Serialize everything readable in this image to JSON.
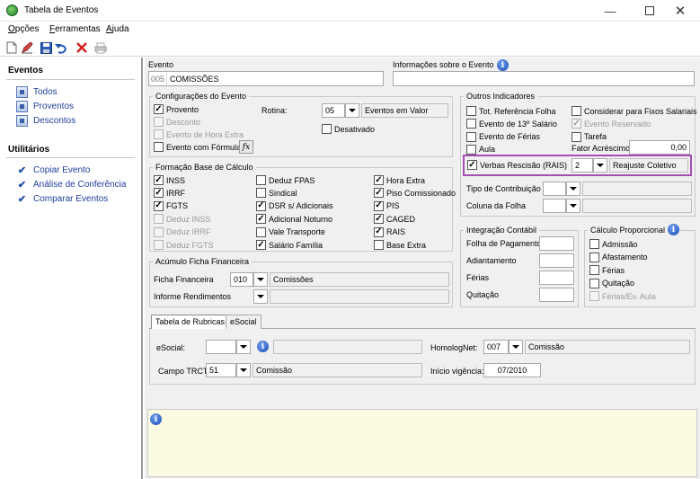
{
  "window": {
    "title": "Tabela de Eventos"
  },
  "menu": [
    {
      "label": "Opções",
      "u": "O",
      "rest": "pções"
    },
    {
      "label": "Ferramentas",
      "u": "F",
      "rest": "erramentas"
    },
    {
      "label": "Ajuda",
      "u": "A",
      "rest": "juda"
    }
  ],
  "toolbar": [
    "new-document",
    "edit",
    "save",
    "undo",
    "delete",
    "print"
  ],
  "sidebar": {
    "eventos_heading": "Eventos",
    "eventos": [
      "Todos",
      "Proventos",
      "Descontos"
    ],
    "utilitarios_heading": "Utilitários",
    "utilitarios": [
      "Copiar Evento",
      "Análise de Conferência",
      "Comparar Eventos"
    ]
  },
  "evento": {
    "label": "Evento",
    "code": "005",
    "name": "COMISSÕES",
    "info_label": "Informações sobre o Evento",
    "info_value": ""
  },
  "config": {
    "title": "Configurações do Evento",
    "provento": "Provento",
    "provento_checked": true,
    "desconto": "Desconto",
    "hora_extra": "Evento de Hora Extra",
    "formula": "Evento com Fórmula",
    "formula_btn": "fx",
    "rotina_label": "Rotina:",
    "rotina_value": "05",
    "rotina_desc": "Eventos em Valor",
    "desativado": "Desativado"
  },
  "formacao": {
    "title": "Formação Base de Cálculo",
    "col1": [
      {
        "t": "INSS",
        "c": true,
        "d": false
      },
      {
        "t": "IRRF",
        "c": true,
        "d": false
      },
      {
        "t": "FGTS",
        "c": true,
        "d": false
      },
      {
        "t": "Deduz INSS",
        "c": false,
        "d": true
      },
      {
        "t": "Deduz IRRF",
        "c": false,
        "d": true
      },
      {
        "t": "Deduz FGTS",
        "c": false,
        "d": true
      }
    ],
    "col2": [
      {
        "t": "Deduz FPAS",
        "c": false,
        "d": false
      },
      {
        "t": "Sindical",
        "c": false,
        "d": false
      },
      {
        "t": "DSR s/ Adicionais",
        "c": true,
        "d": false
      },
      {
        "t": "Adicional Noturno",
        "c": true,
        "d": false
      },
      {
        "t": "Vale Transporte",
        "c": false,
        "d": false
      },
      {
        "t": "Salário Família",
        "c": true,
        "d": false
      }
    ],
    "col3": [
      {
        "t": "Hora Extra",
        "c": true,
        "d": false
      },
      {
        "t": "Piso Comissionado",
        "c": true,
        "d": false
      },
      {
        "t": "PIS",
        "c": true,
        "d": false
      },
      {
        "t": "CAGED",
        "c": true,
        "d": false
      },
      {
        "t": "RAIS",
        "c": true,
        "d": false
      },
      {
        "t": "Base Extra",
        "c": false,
        "d": false
      }
    ]
  },
  "acumulo": {
    "title": "Acúmulo Ficha Financeira",
    "ficha_label": "Ficha Financeira",
    "ficha_code": "010",
    "ficha_desc": "Comissões",
    "informe_label": "Informe Rendimentos"
  },
  "outros": {
    "title": "Outros Indicadores",
    "col1": [
      {
        "t": "Tot. Referência Folha",
        "c": false,
        "d": false
      },
      {
        "t": "Evento de 13º Salário",
        "c": false,
        "d": false
      },
      {
        "t": "Evento de Férias",
        "c": false,
        "d": false
      },
      {
        "t": "Aula",
        "c": false,
        "d": false
      }
    ],
    "col2": [
      {
        "t": "Considerar para Fixos Salariais",
        "c": false,
        "d": false
      },
      {
        "t": "Evento Reservado",
        "c": true,
        "d": true
      },
      {
        "t": "Tarefa",
        "c": false,
        "d": false
      }
    ],
    "fator_label": "Fator Acréscimo",
    "fator_value": "0,00",
    "verbas_label": "Verbas Rescisão (RAIS)",
    "verbas_code": "2",
    "verbas_desc": "Reajuste Coletivo",
    "tipo_label": "Tipo de Contribuição",
    "coluna_label": "Coluna da Folha"
  },
  "integracao": {
    "title": "Integração Contábil",
    "rows": [
      "Folha de Pagamento",
      "Adiantamento",
      "Férias",
      "Quitação"
    ]
  },
  "proporcional": {
    "title": "Cálculo Proporcional",
    "rows": [
      {
        "t": "Admissão",
        "d": false
      },
      {
        "t": "Afastamento",
        "d": false
      },
      {
        "t": "Férias",
        "d": false
      },
      {
        "t": "Quitação",
        "d": false
      },
      {
        "t": "Férias/Ev. Aula",
        "d": true
      }
    ]
  },
  "tabs": [
    "Tabela de Rubricas",
    "eSocial"
  ],
  "rubricas": {
    "esocial_label": "eSocial:",
    "esocial_value": "",
    "trct_label": "Campo TRCT:",
    "trct_code": "51",
    "trct_desc": "Comissão",
    "homolog_label": "HomologNet:",
    "homolog_code": "007",
    "homolog_desc": "Comissão",
    "inicio_label": "Início vigência:",
    "inicio_value": "07/2010"
  },
  "colors": {
    "highlight": "#a64db5",
    "note_bg": "#fbfbe2",
    "link": "#1e3f9a"
  }
}
